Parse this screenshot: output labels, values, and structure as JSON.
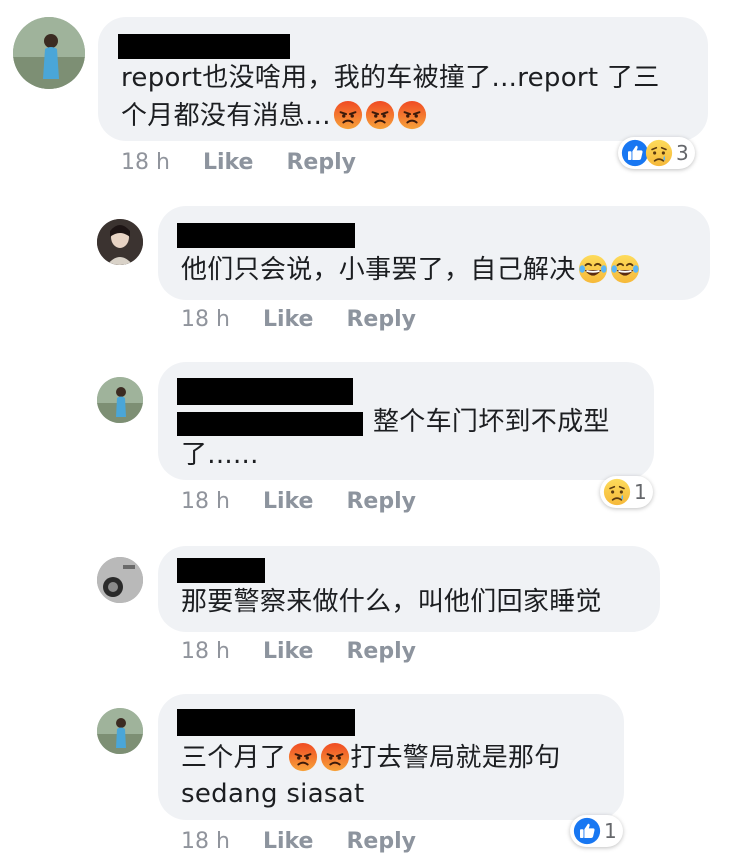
{
  "comments": [
    {
      "text_line1": "report也没啥用，我的车被撞了...report 了三",
      "text_line2": "个月都没有消息...",
      "time": "18 h",
      "like": "Like",
      "reply": "Reply",
      "reaction_count": "3"
    },
    {
      "text_line1": "他们只会说，小事罢了，自己解决",
      "time": "18 h",
      "like": "Like",
      "reply": "Reply"
    },
    {
      "text_line1": "整个车门坏到不成型",
      "text_line2": "了......",
      "time": "18 h",
      "like": "Like",
      "reply": "Reply",
      "reaction_count": "1"
    },
    {
      "text_line1": "那要警察来做什么，叫他们回家睡觉",
      "time": "18 h",
      "like": "Like",
      "reply": "Reply"
    },
    {
      "text_line1_a": "三个月了",
      "text_line1_b": "打去警局就是那句",
      "text_line2": "sedang siasat",
      "time": "18 h",
      "like": "Like",
      "reply": "Reply",
      "reaction_count": "1"
    }
  ],
  "icons": {
    "angry": "angry-emoji",
    "laugh": "laughing-crying-emoji",
    "like": "like-reaction",
    "sad": "sad-reaction"
  },
  "colors": {
    "bubble": "#f0f2f5",
    "meta": "#90949c",
    "like_blue": "#1877f2",
    "angry_red": "#e8542e",
    "sad_yellow": "#f7c948"
  }
}
